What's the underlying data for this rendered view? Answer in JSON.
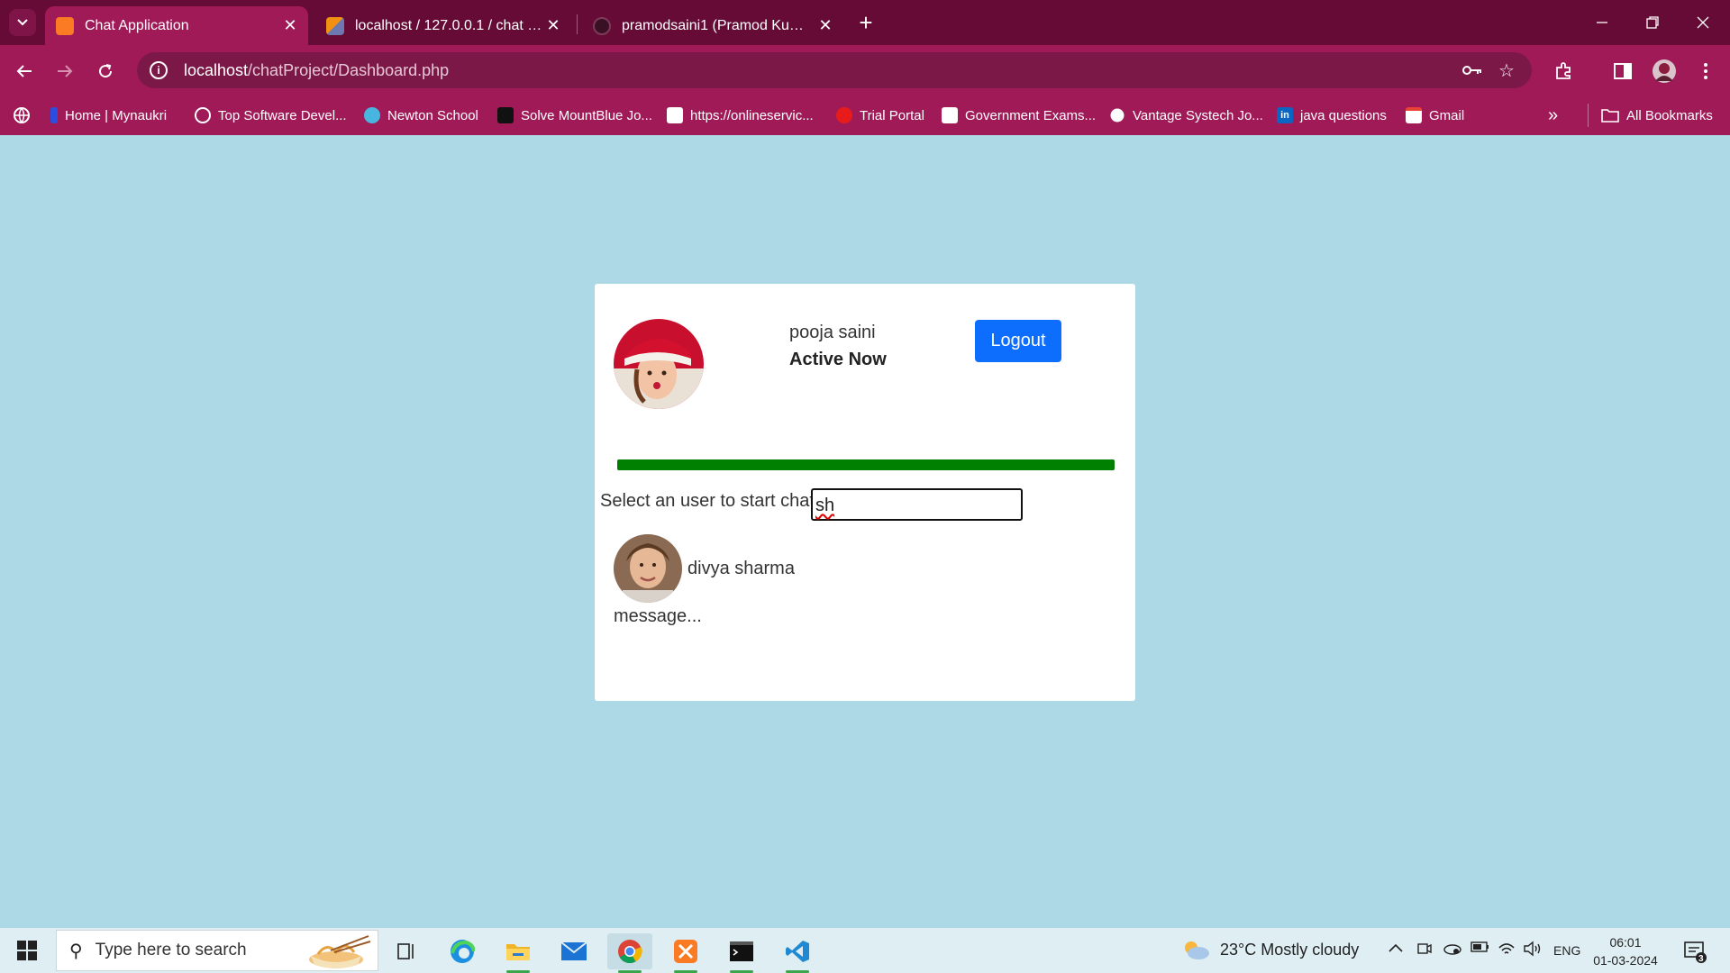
{
  "browser": {
    "tabs": [
      {
        "title": "Chat Application",
        "active": true
      },
      {
        "title": "localhost / 127.0.0.1 / chat / me",
        "active": false
      },
      {
        "title": "pramodsaini1 (Pramod Kumar S",
        "active": false
      }
    ],
    "url_host": "localhost",
    "url_path": "/chatProject/Dashboard.php",
    "bookmarks": [
      "Home | Mynaukri",
      "Top Software Devel...",
      "Newton School",
      "Solve MountBlue Jo...",
      "https://onlineservic...",
      "Trial Portal",
      "Government Exams...",
      "Vantage Systech Jo...",
      "java questions",
      "Gmail"
    ],
    "all_bookmarks": "All Bookmarks"
  },
  "dashboard": {
    "user_name": "pooja saini",
    "status": "Active Now",
    "logout_label": "Logout",
    "progress_fraction": 1.0,
    "select_label": "Select an user to start chat",
    "search_value": "sh",
    "users": [
      {
        "name": "divya sharma",
        "last_message": "message..."
      }
    ]
  },
  "taskbar": {
    "search_placeholder": "Type here to search",
    "weather": "23°C  Mostly cloudy",
    "language": "ENG",
    "time": "06:01",
    "date": "01-03-2024",
    "notification_count": "3"
  },
  "colors": {
    "page_bg": "#add8e6",
    "chrome_dark": "#660a36",
    "chrome": "#a01a58",
    "logout_button": "#0d6efd",
    "progress": "#008000"
  }
}
